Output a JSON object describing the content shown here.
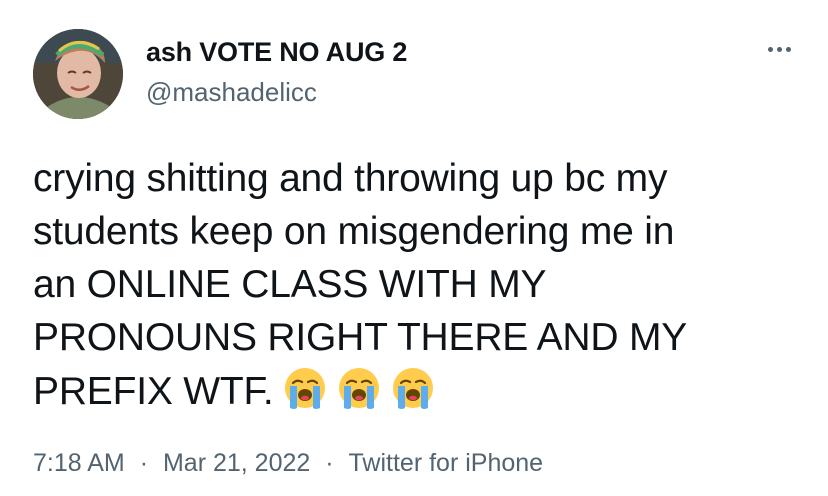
{
  "author": {
    "display_name": "ash VOTE NO AUG 2",
    "handle": "@mashadelicc",
    "avatar": "profile-photo"
  },
  "tweet": {
    "lines": [
      "crying shitting and throwing up bc my",
      "students keep on misgendering me in",
      "an ONLINE CLASS WITH MY",
      "PRONOUNS RIGHT THERE AND MY",
      "PREFIX WTF."
    ],
    "emojis": [
      "loudly-crying-face-emoji",
      "loudly-crying-face-emoji",
      "loudly-crying-face-emoji"
    ]
  },
  "meta": {
    "time": "7:18 AM",
    "separator": "·",
    "date": "Mar 21, 2022",
    "source": "Twitter for iPhone"
  },
  "icons": {
    "more": "more-options-icon"
  },
  "colors": {
    "text": "#0f1419",
    "secondary": "#536471",
    "emoji_face": "#ffcc4d",
    "emoji_tears": "#5dadec"
  }
}
